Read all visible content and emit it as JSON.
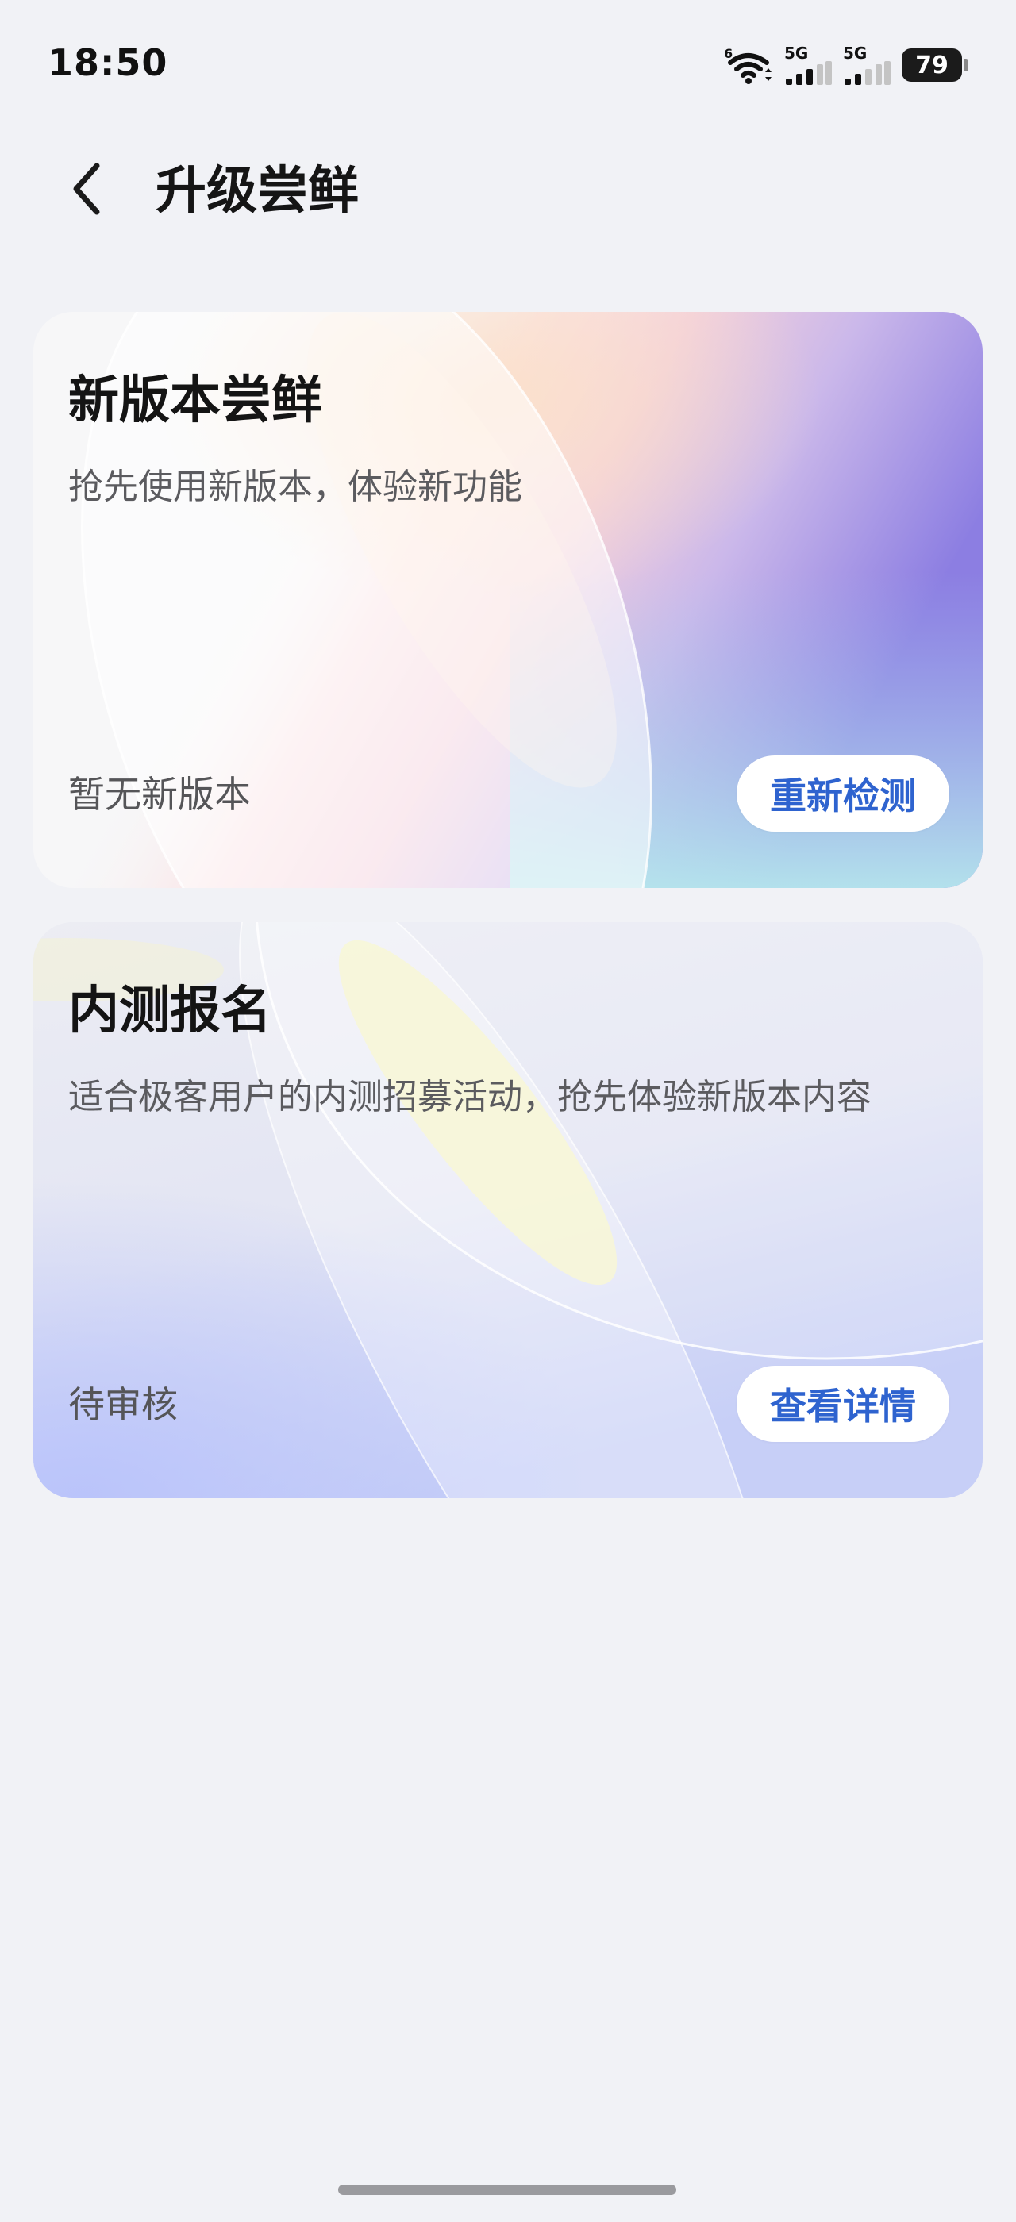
{
  "status_bar": {
    "time": "18:50",
    "battery": "79",
    "network_1": "5G",
    "network_2": "5G",
    "wifi_badge": "6"
  },
  "header": {
    "title": "升级尝鲜"
  },
  "cards": [
    {
      "title": "新版本尝鲜",
      "desc": "抢先使用新版本，体验新功能",
      "status": "暂无新版本",
      "button": "重新检测"
    },
    {
      "title": "内测报名",
      "desc": "适合极客用户的内测招募活动，抢先体验新版本内容",
      "status": "待审核",
      "button": "查看详情"
    }
  ],
  "icons": {
    "back": "chevron-left-icon",
    "wifi": "wifi-icon",
    "signal": "signal-icon",
    "battery": "battery-icon"
  },
  "colors": {
    "background": "#f1f2f6",
    "accent": "#2e63cf",
    "card_1": "#f7f7f8",
    "card_2": "#e6e8f3"
  }
}
